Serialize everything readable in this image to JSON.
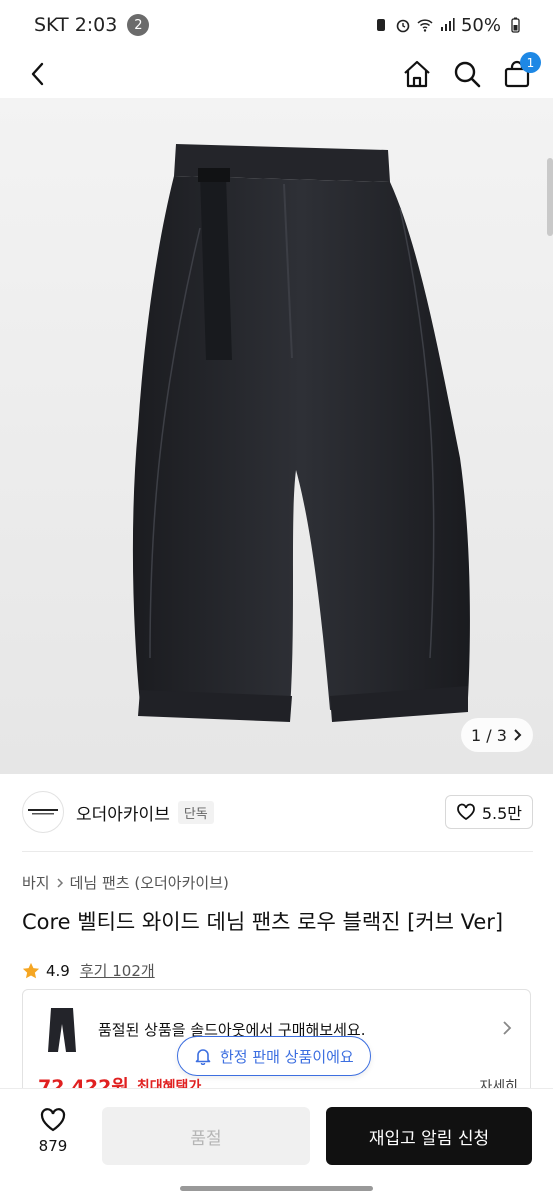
{
  "status_bar": {
    "time": "SKT 2:03",
    "notification_count": "2",
    "battery": "50%"
  },
  "header": {
    "cart_count": "1"
  },
  "image": {
    "counter": "1 / 3"
  },
  "brand": {
    "name": "오더아카이브",
    "tag": "단독",
    "likes": "5.5만"
  },
  "breadcrumb": {
    "level1": "바지",
    "level2": "데님 팬츠 (오더아카이브)"
  },
  "product": {
    "title": "Core 벨티드 와이드 데님 팬츠 로우 블랙진 [커브 Ver]",
    "rating": "4.9",
    "reviews": "후기 102개"
  },
  "soldout_notice": {
    "text": "품절된 상품을 솔드아웃에서 구매해보세요."
  },
  "price": {
    "value": "72,422원",
    "label": "최대혜택가",
    "more": "자세히"
  },
  "limited_chip": {
    "label": "한정 판매 상품이에요"
  },
  "bottom_bar": {
    "like_count": "879",
    "soldout_label": "품절",
    "restock_label": "재입고 알림 신청"
  },
  "colors": {
    "accent_blue": "#3d6fe0",
    "badge_blue": "#1e88e5",
    "price_red": "#e02020",
    "star": "#f5a623"
  }
}
